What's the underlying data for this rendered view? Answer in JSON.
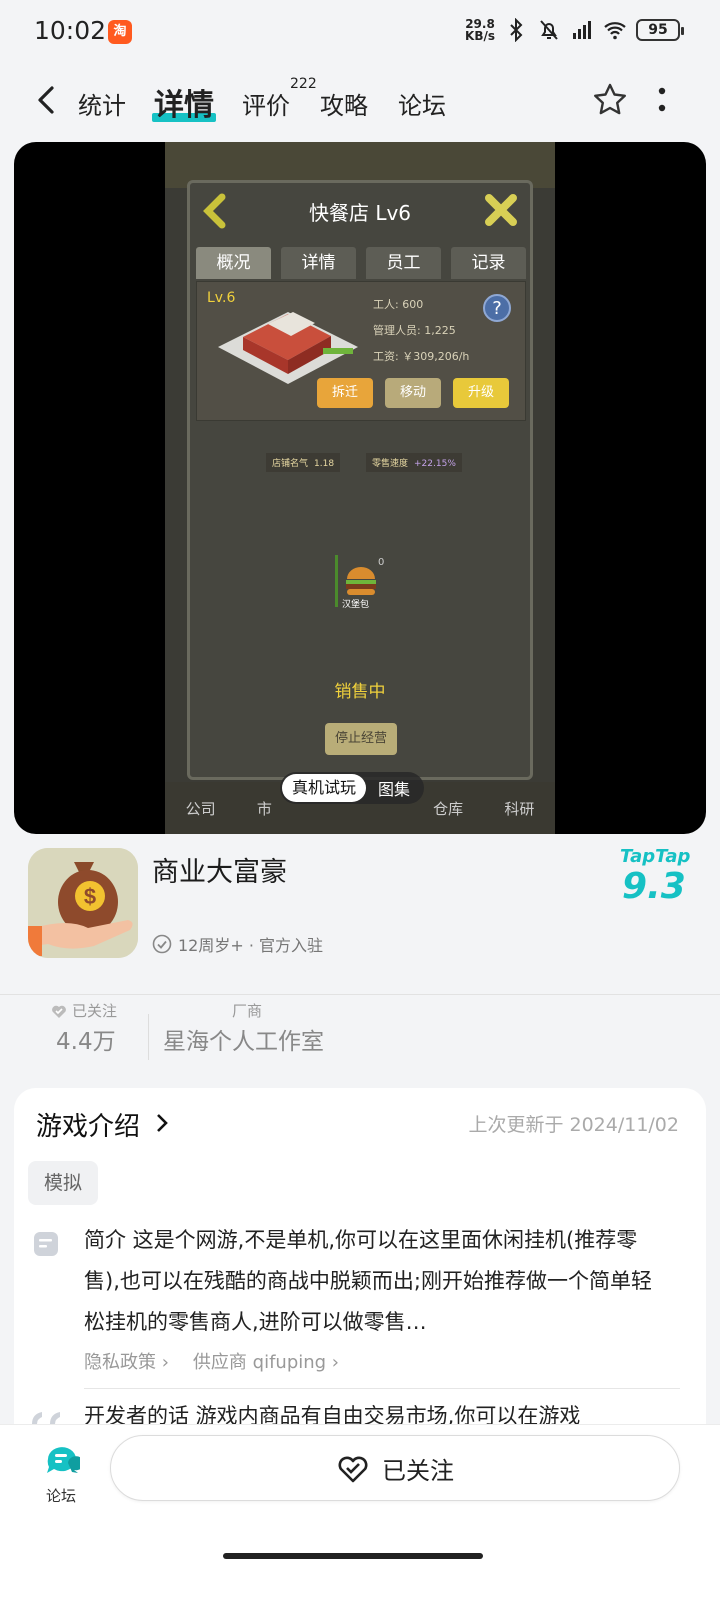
{
  "status": {
    "time": "10:02",
    "taobao_badge": "淘",
    "speed_top": "29.8",
    "speed_unit": "KB/s",
    "battery": "95"
  },
  "nav": {
    "tabs": [
      "统计",
      "详情",
      "评价",
      "攻略",
      "论坛"
    ],
    "active_tab": "详情",
    "review_count": "222"
  },
  "media": {
    "game": {
      "title": "快餐店 Lv6",
      "tabs": [
        "概况",
        "详情",
        "员工",
        "记录"
      ],
      "level": "Lv.6",
      "workers": "工人: 600",
      "managers": "管理人员: 1,225",
      "wage": "工资: ￥309,206/h",
      "buttons": [
        "拆迁",
        "移动",
        "升级"
      ],
      "reputation_label": "店铺名气",
      "reputation_value": "1.18",
      "retail_label": "零售速度",
      "retail_value": "+22.15%",
      "item_name": "汉堡包",
      "item_count": "0",
      "status": "销售中",
      "stop_btn": "停止经营",
      "bottom_nav": [
        "公司",
        "市",
        "仓库",
        "科研"
      ]
    },
    "pill_active": "真机试玩",
    "pill_other": "图集"
  },
  "app": {
    "name": "商业大富豪",
    "meta": "12周岁+ · 官方入驻",
    "brand": "TapTap",
    "score": "9.3"
  },
  "stats": {
    "follow_label": "已关注",
    "follow_value": "4.4万",
    "vendor_label": "厂商",
    "vendor_value": "星海个人工作室"
  },
  "intro": {
    "title": "游戏介绍",
    "updated": "上次更新于 2024/11/02",
    "tag": "模拟",
    "description": "简介 这是个网游,不是单机,你可以在这里面休闲挂机(推荐零售),也可以在残酷的商战中脱颖而出;刚开始推荐做一个简单轻松挂机的零售商人,进阶可以做零售…",
    "privacy": "隐私政策",
    "supplier": "供应商 qifuping",
    "dev_words": "开发者的话 游戏内商品有自由交易市场,你可以在游戏"
  },
  "bottom": {
    "forum_label": "论坛",
    "follow_btn": "已关注"
  },
  "colors": {
    "accent": "#16c1c4",
    "game_yellow": "#f0d13c"
  }
}
